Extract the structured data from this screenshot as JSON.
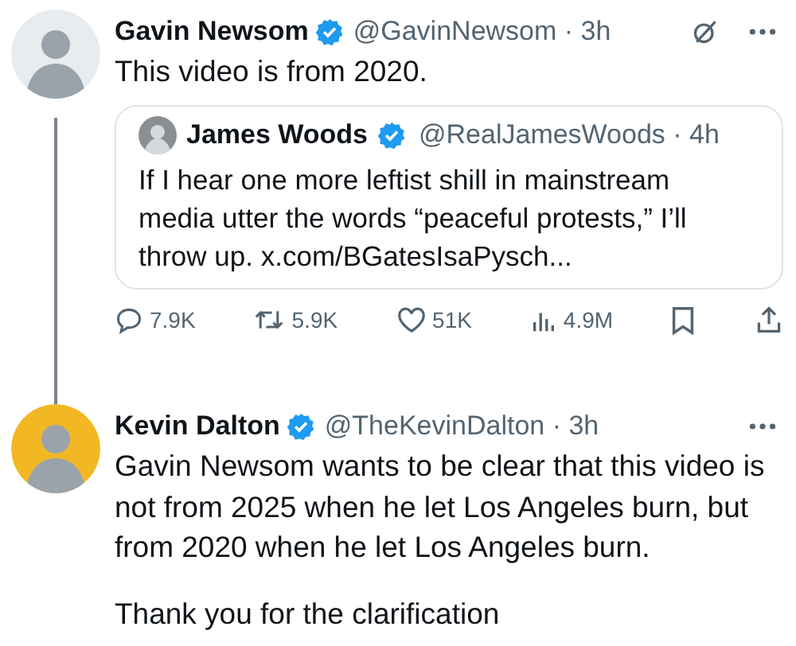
{
  "tweets": [
    {
      "author": {
        "name": "Gavin Newsom",
        "meta": "@GavinNewsom · 3h",
        "verified": true
      },
      "grok_button": true,
      "body": [
        "This video is from 2020."
      ],
      "quote": {
        "author": {
          "name": "James Woods",
          "meta": "@RealJamesWoods · 4h",
          "verified": true
        },
        "text": "If I hear one more leftist shill in mainstream media utter the words “peaceful protests,” I’ll throw up.  x.com/BGatesIsaPysch..."
      },
      "actions": [
        {
          "kind": "reply",
          "count": "7.9K"
        },
        {
          "kind": "repost",
          "count": "5.9K"
        },
        {
          "kind": "like",
          "count": "51K"
        },
        {
          "kind": "views",
          "count": "4.9M"
        },
        {
          "kind": "bookmark"
        },
        {
          "kind": "share"
        }
      ]
    },
    {
      "author": {
        "name": "Kevin Dalton",
        "meta": "@TheKevinDalton · 3h",
        "verified": true
      },
      "body": [
        "Gavin Newsom wants to be clear that this video is not from 2025 when he let Los Angeles burn, but from 2020 when he let Los Angeles burn.",
        "Thank you for the clarification"
      ]
    }
  ]
}
